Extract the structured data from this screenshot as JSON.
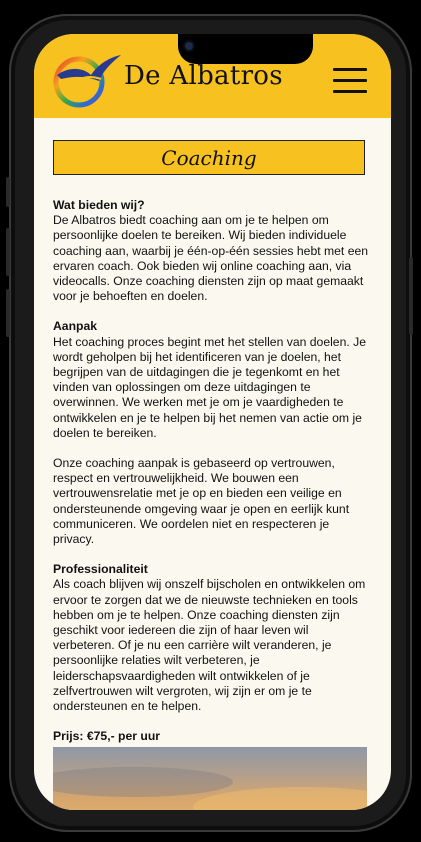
{
  "header": {
    "brand_name": "De Albatros",
    "brand_color": "#f7c120"
  },
  "page": {
    "title": "Coaching"
  },
  "sections": [
    {
      "heading": "Wat bieden wij?",
      "paragraphs": [
        "De Albatros biedt coaching aan om je te helpen om persoonlijke doelen te bereiken. Wij bieden individuele coaching aan, waarbij je één-op-één sessies hebt met een ervaren coach. Ook bieden wij online coaching aan, via videocalls. Onze coaching diensten zijn op maat gemaakt voor je behoeften en doelen."
      ]
    },
    {
      "heading": "Aanpak",
      "paragraphs": [
        "Het coaching proces begint met het stellen van doelen. Je wordt geholpen bij het identificeren van je doelen, het begrijpen van de uitdagingen die je tegenkomt en het vinden van oplossingen om deze uitdagingen te overwinnen. We werken met je om je vaardigheden te ontwikkelen en je te helpen bij het nemen van actie om je doelen te bereiken.",
        "Onze coaching aanpak is gebaseerd op vertrouwen, respect en vertrouwelijkheid. We bouwen een vertrouwensrelatie met je op en bieden een veilige en ondersteunende omgeving waar je open en eerlijk kunt communiceren. We oordelen niet en respecteren je privacy."
      ]
    },
    {
      "heading": "Professionaliteit",
      "paragraphs": [
        "Als coach blijven wij onszelf bijscholen en ontwikkelen om ervoor te zorgen dat we de nieuwste technieken en tools hebben om je te helpen. Onze coaching diensten zijn geschikt voor iedereen die zijn of haar leven wil verbeteren. Of je nu een carrière wilt veranderen, je persoonlijke relaties wilt verbeteren, je leiderschapsvaardigheden wilt ontwikkelen of je zelfvertrouwen wilt vergroten, wij zijn er om je te ondersteunen en te helpen."
      ]
    }
  ],
  "price": "Prijs: €75,- per uur",
  "icons": {
    "logo": "albatros-logo",
    "menu": "hamburger-menu-icon"
  }
}
